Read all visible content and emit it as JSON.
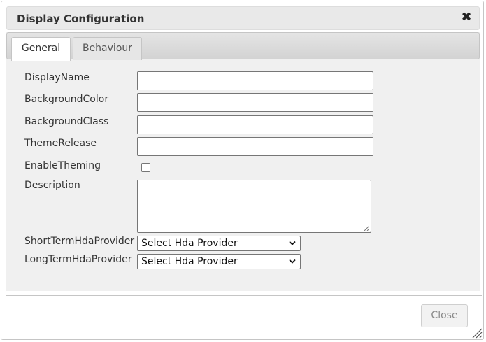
{
  "dialog": {
    "title": "Display Configuration",
    "close_icon": "close-x-icon"
  },
  "tabs": [
    {
      "label": "General",
      "active": true
    },
    {
      "label": "Behaviour",
      "active": false
    }
  ],
  "form": {
    "display_name": {
      "label": "DisplayName",
      "value": ""
    },
    "background_color": {
      "label": "BackgroundColor",
      "value": ""
    },
    "background_class": {
      "label": "BackgroundClass",
      "value": ""
    },
    "theme_release": {
      "label": "ThemeRelease",
      "value": ""
    },
    "enable_theming": {
      "label": "EnableTheming",
      "checked": false
    },
    "description": {
      "label": "Description",
      "value": ""
    },
    "short_term_hda_provider": {
      "label": "ShortTermHdaProvider",
      "selected": "Select Hda Provider"
    },
    "long_term_hda_provider": {
      "label": "LongTermHdaProvider",
      "selected": "Select Hda Provider"
    }
  },
  "footer": {
    "close_label": "Close"
  }
}
